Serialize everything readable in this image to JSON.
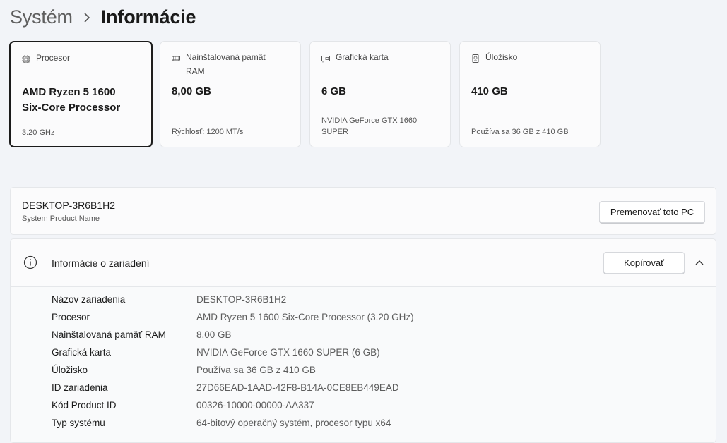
{
  "breadcrumb": {
    "parent": "Systém",
    "current": "Informácie"
  },
  "cards": [
    {
      "label": "Procesor",
      "value_line1": "AMD Ryzen 5 1600",
      "value_line2": "Six-Core Processor",
      "sub": "3.20 GHz",
      "icon": "chip-icon"
    },
    {
      "label": "Nainštalovaná pamäť RAM",
      "value_line1": "8,00 GB",
      "sub": "Rýchlosť: 1200 MT/s",
      "icon": "ram-icon"
    },
    {
      "label": "Grafická karta",
      "value_line1": "6 GB",
      "sub_line1": "NVIDIA GeForce GTX 1660",
      "sub_line2": "SUPER",
      "icon": "gpu-icon"
    },
    {
      "label": "Úložisko",
      "value_line1": "410 GB",
      "sub": "Používa sa 36 GB z 410 GB",
      "icon": "storage-icon"
    }
  ],
  "pc": {
    "name": "DESKTOP-3R6B1H2",
    "sub": "System Product Name",
    "rename_label": "Premenovať toto PC"
  },
  "device_info": {
    "title": "Informácie o zariadení",
    "copy_label": "Kopírovať",
    "rows": [
      {
        "key": "Názov zariadenia",
        "value": "DESKTOP-3R6B1H2"
      },
      {
        "key": "Procesor",
        "value": "AMD Ryzen 5 1600 Six-Core Processor (3.20 GHz)"
      },
      {
        "key": "Nainštalovaná pamäť RAM",
        "value": "8,00 GB"
      },
      {
        "key": "Grafická karta",
        "value": "NVIDIA GeForce GTX 1660 SUPER (6 GB)"
      },
      {
        "key": "Úložisko",
        "value": "Používa sa 36 GB z 410 GB"
      },
      {
        "key": "ID zariadenia",
        "value": "27D66EAD-1AAD-42F8-B14A-0CE8EB449EAD"
      },
      {
        "key": "Kód Product ID",
        "value": "00326-10000-00000-AA337"
      },
      {
        "key": "Typ systému",
        "value": "64-bitový operačný systém, procesor typu x64"
      }
    ]
  }
}
